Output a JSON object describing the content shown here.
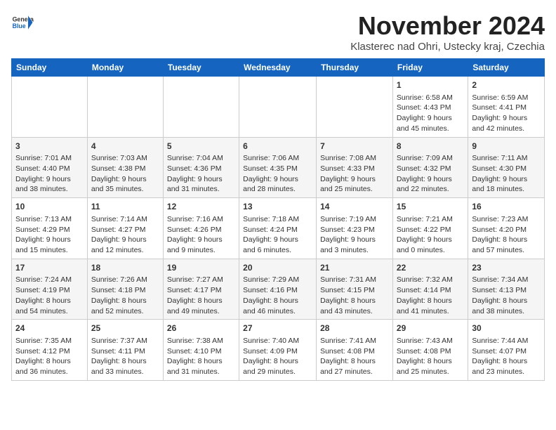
{
  "header": {
    "logo_general": "General",
    "logo_blue": "Blue",
    "month_title": "November 2024",
    "location": "Klasterec nad Ohri, Ustecky kraj, Czechia"
  },
  "weekdays": [
    "Sunday",
    "Monday",
    "Tuesday",
    "Wednesday",
    "Thursday",
    "Friday",
    "Saturday"
  ],
  "weeks": [
    {
      "row": 1,
      "days": [
        {
          "date": "",
          "info": ""
        },
        {
          "date": "",
          "info": ""
        },
        {
          "date": "",
          "info": ""
        },
        {
          "date": "",
          "info": ""
        },
        {
          "date": "",
          "info": ""
        },
        {
          "date": "1",
          "info": "Sunrise: 6:58 AM\nSunset: 4:43 PM\nDaylight: 9 hours\nand 45 minutes."
        },
        {
          "date": "2",
          "info": "Sunrise: 6:59 AM\nSunset: 4:41 PM\nDaylight: 9 hours\nand 42 minutes."
        }
      ]
    },
    {
      "row": 2,
      "days": [
        {
          "date": "3",
          "info": "Sunrise: 7:01 AM\nSunset: 4:40 PM\nDaylight: 9 hours\nand 38 minutes."
        },
        {
          "date": "4",
          "info": "Sunrise: 7:03 AM\nSunset: 4:38 PM\nDaylight: 9 hours\nand 35 minutes."
        },
        {
          "date": "5",
          "info": "Sunrise: 7:04 AM\nSunset: 4:36 PM\nDaylight: 9 hours\nand 31 minutes."
        },
        {
          "date": "6",
          "info": "Sunrise: 7:06 AM\nSunset: 4:35 PM\nDaylight: 9 hours\nand 28 minutes."
        },
        {
          "date": "7",
          "info": "Sunrise: 7:08 AM\nSunset: 4:33 PM\nDaylight: 9 hours\nand 25 minutes."
        },
        {
          "date": "8",
          "info": "Sunrise: 7:09 AM\nSunset: 4:32 PM\nDaylight: 9 hours\nand 22 minutes."
        },
        {
          "date": "9",
          "info": "Sunrise: 7:11 AM\nSunset: 4:30 PM\nDaylight: 9 hours\nand 18 minutes."
        }
      ]
    },
    {
      "row": 3,
      "days": [
        {
          "date": "10",
          "info": "Sunrise: 7:13 AM\nSunset: 4:29 PM\nDaylight: 9 hours\nand 15 minutes."
        },
        {
          "date": "11",
          "info": "Sunrise: 7:14 AM\nSunset: 4:27 PM\nDaylight: 9 hours\nand 12 minutes."
        },
        {
          "date": "12",
          "info": "Sunrise: 7:16 AM\nSunset: 4:26 PM\nDaylight: 9 hours\nand 9 minutes."
        },
        {
          "date": "13",
          "info": "Sunrise: 7:18 AM\nSunset: 4:24 PM\nDaylight: 9 hours\nand 6 minutes."
        },
        {
          "date": "14",
          "info": "Sunrise: 7:19 AM\nSunset: 4:23 PM\nDaylight: 9 hours\nand 3 minutes."
        },
        {
          "date": "15",
          "info": "Sunrise: 7:21 AM\nSunset: 4:22 PM\nDaylight: 9 hours\nand 0 minutes."
        },
        {
          "date": "16",
          "info": "Sunrise: 7:23 AM\nSunset: 4:20 PM\nDaylight: 8 hours\nand 57 minutes."
        }
      ]
    },
    {
      "row": 4,
      "days": [
        {
          "date": "17",
          "info": "Sunrise: 7:24 AM\nSunset: 4:19 PM\nDaylight: 8 hours\nand 54 minutes."
        },
        {
          "date": "18",
          "info": "Sunrise: 7:26 AM\nSunset: 4:18 PM\nDaylight: 8 hours\nand 52 minutes."
        },
        {
          "date": "19",
          "info": "Sunrise: 7:27 AM\nSunset: 4:17 PM\nDaylight: 8 hours\nand 49 minutes."
        },
        {
          "date": "20",
          "info": "Sunrise: 7:29 AM\nSunset: 4:16 PM\nDaylight: 8 hours\nand 46 minutes."
        },
        {
          "date": "21",
          "info": "Sunrise: 7:31 AM\nSunset: 4:15 PM\nDaylight: 8 hours\nand 43 minutes."
        },
        {
          "date": "22",
          "info": "Sunrise: 7:32 AM\nSunset: 4:14 PM\nDaylight: 8 hours\nand 41 minutes."
        },
        {
          "date": "23",
          "info": "Sunrise: 7:34 AM\nSunset: 4:13 PM\nDaylight: 8 hours\nand 38 minutes."
        }
      ]
    },
    {
      "row": 5,
      "days": [
        {
          "date": "24",
          "info": "Sunrise: 7:35 AM\nSunset: 4:12 PM\nDaylight: 8 hours\nand 36 minutes."
        },
        {
          "date": "25",
          "info": "Sunrise: 7:37 AM\nSunset: 4:11 PM\nDaylight: 8 hours\nand 33 minutes."
        },
        {
          "date": "26",
          "info": "Sunrise: 7:38 AM\nSunset: 4:10 PM\nDaylight: 8 hours\nand 31 minutes."
        },
        {
          "date": "27",
          "info": "Sunrise: 7:40 AM\nSunset: 4:09 PM\nDaylight: 8 hours\nand 29 minutes."
        },
        {
          "date": "28",
          "info": "Sunrise: 7:41 AM\nSunset: 4:08 PM\nDaylight: 8 hours\nand 27 minutes."
        },
        {
          "date": "29",
          "info": "Sunrise: 7:43 AM\nSunset: 4:08 PM\nDaylight: 8 hours\nand 25 minutes."
        },
        {
          "date": "30",
          "info": "Sunrise: 7:44 AM\nSunset: 4:07 PM\nDaylight: 8 hours\nand 23 minutes."
        }
      ]
    }
  ]
}
